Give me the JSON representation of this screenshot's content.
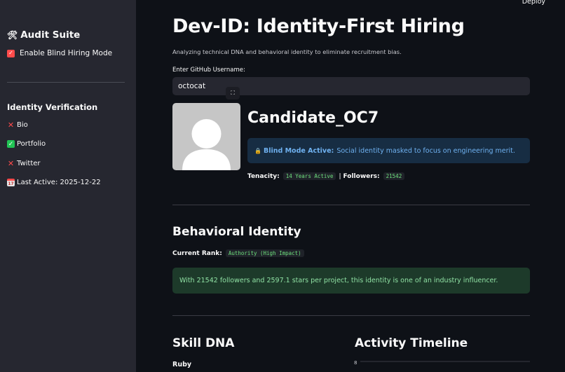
{
  "header": {
    "deploy_label": "Deploy"
  },
  "sidebar": {
    "title": "Audit Suite",
    "title_icon": "hammer-wrench-icon",
    "blind_mode": {
      "label": "Enable Blind Hiring Mode",
      "checked": true
    },
    "verification_title": "Identity Verification",
    "items": [
      {
        "label": "Bio",
        "status": "missing",
        "icon": "cross-icon"
      },
      {
        "label": "Portfolio",
        "status": "present",
        "icon": "check-icon"
      },
      {
        "label": "Twitter",
        "status": "missing",
        "icon": "cross-icon"
      },
      {
        "label": "Last Active: 2025-12-22",
        "icon": "calendar-icon"
      }
    ]
  },
  "main": {
    "title": "Dev-ID: Identity-First Hiring",
    "subtitle": "Analyzing technical DNA and behavioral identity to eliminate recruitment bias.",
    "input": {
      "label": "Enter GitHub Username:",
      "value": "octocat"
    },
    "candidate": {
      "name": "Candidate_OC7",
      "info_strong": "Blind Mode Active:",
      "info_text": "Social identity masked to focus on engineering merit.",
      "tenacity_label": "Tenacity:",
      "tenacity_value": "14 Years Active",
      "separator": "|",
      "followers_label": "Followers:",
      "followers_value": "21542"
    },
    "behavioral": {
      "title": "Behavioral Identity",
      "rank_label": "Current Rank:",
      "rank_value": "Authority (High Impact)",
      "message": "With 21542 followers and 2597.1 stars per project, this identity is one of an industry influencer."
    },
    "skill": {
      "title": "Skill DNA",
      "first_language": "Ruby"
    },
    "activity": {
      "title": "Activity Timeline",
      "y_tick": "8"
    }
  },
  "colors": {
    "background": "#0e1117",
    "sidebar": "#262730",
    "accent": "#ff4b4b",
    "info_bg": "#172d43",
    "info_text": "#6fb1f0",
    "success_bg": "#1d3a2a",
    "success_text": "#8fe0a3",
    "code_text": "#6ee07d"
  }
}
